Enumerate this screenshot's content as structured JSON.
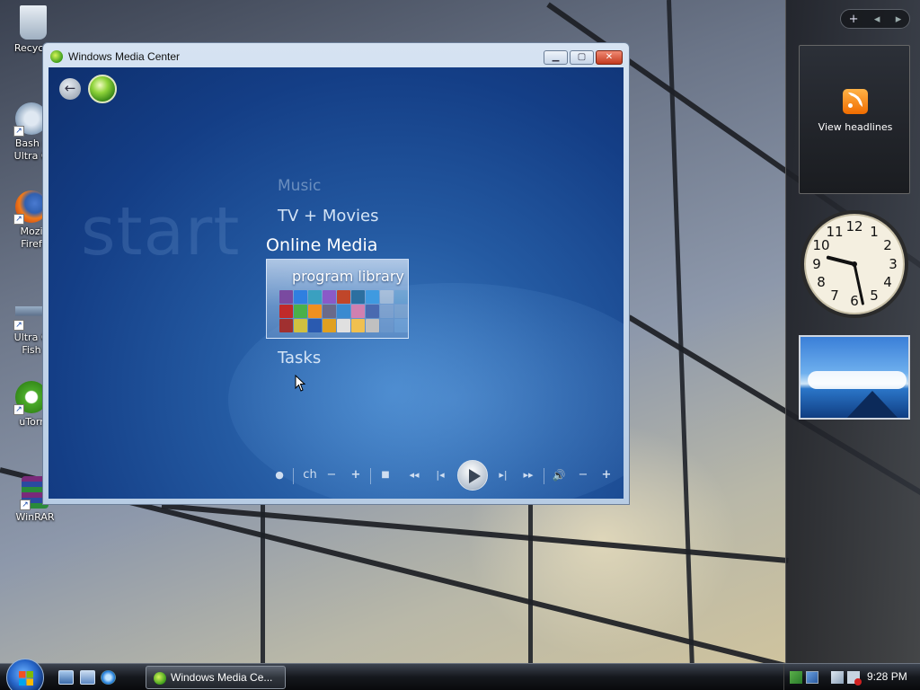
{
  "desktop": {
    "icons": [
      {
        "label": "Recycle",
        "icon": "recycle-bin-icon"
      },
      {
        "label": "Bash s\nUltra G",
        "icon": "gear-app-icon"
      },
      {
        "label": "Mozi\nFiref",
        "icon": "firefox-icon"
      },
      {
        "label": "Ultra G\nFish",
        "icon": "fish-icon"
      },
      {
        "label": "uTorr",
        "icon": "utorrent-icon"
      },
      {
        "label": "WinRAR",
        "icon": "winrar-icon"
      }
    ]
  },
  "sidebar": {
    "controls": {
      "add": "+",
      "prev": "◂",
      "next": "▸"
    },
    "feed": {
      "label": "View headlines",
      "icon": "rss-icon"
    },
    "clock": {
      "hour": 9,
      "minute": 28
    },
    "slideshow": {
      "icon": "slideshow-photo"
    }
  },
  "wmc": {
    "title": "Windows Media Center",
    "start_label": "start",
    "menu": {
      "music": "Music",
      "tv_movies": "TV + Movies",
      "online_media": "Online Media",
      "program_library": "program library",
      "tasks": "Tasks"
    },
    "transport": {
      "record": "●",
      "channel": "ch",
      "ch_down": "−",
      "ch_up": "+",
      "stop": "■",
      "rewind": "◂◂",
      "skip_back": "|◂",
      "play": "play",
      "skip_fwd": "▸|",
      "fast_fwd": "▸▸",
      "mute": "🔊",
      "vol_down": "−",
      "vol_up": "+"
    },
    "library_tiles": [
      "#7a4aa0",
      "#2f7fe0",
      "#3aa0c0",
      "#8a5ac8",
      "#c0462a",
      "#2c6fa0",
      "#3f9ae0",
      "#e0e0e0",
      "#5aa0d0",
      "#c02a2a",
      "#4ab04a",
      "#f09020",
      "#6a6a8a",
      "#3a8ad0",
      "#d080b0",
      "#4a6ab0",
      "#9ab0d0",
      "#90b0d0",
      "#a03030",
      "#d0c040",
      "#2a5ab0",
      "#e0a020",
      "#e0e0e0",
      "#f0c050",
      "#c0c0c0",
      "#7aa0d0",
      "#7ab0e0"
    ]
  },
  "taskbar": {
    "start": "Start",
    "quicklaunch": [
      "show-desktop-icon",
      "switch-windows-icon",
      "internet-explorer-icon"
    ],
    "task_label": "Windows Media Ce...",
    "clock": "9:28 PM"
  }
}
